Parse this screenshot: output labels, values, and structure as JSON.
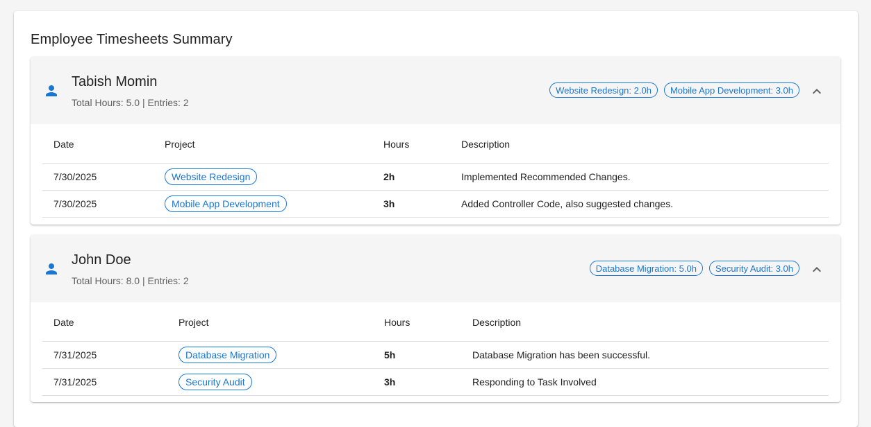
{
  "page": {
    "title": "Employee Timesheets Summary"
  },
  "colors": {
    "accent": "#1976d2",
    "header_bg": "#f5f5f5",
    "divider": "#e0e0e0"
  },
  "icons": {
    "person": "person-icon",
    "collapse": "chevron-up-icon"
  },
  "table_headers": {
    "date": "Date",
    "project": "Project",
    "hours": "Hours",
    "description": "Description"
  },
  "employees": [
    {
      "name": "Tabish Momin",
      "summary": "Total Hours: 5.0 | Entries: 2",
      "chips": [
        "Website Redesign: 2.0h",
        "Mobile App Development: 3.0h"
      ],
      "entries": [
        {
          "date": "7/30/2025",
          "project": "Website Redesign",
          "hours": "2h",
          "description": "Implemented Recommended Changes."
        },
        {
          "date": "7/30/2025",
          "project": "Mobile App Development",
          "hours": "3h",
          "description": "Added Controller Code, also suggested changes."
        }
      ]
    },
    {
      "name": "John Doe",
      "summary": "Total Hours: 8.0 | Entries: 2",
      "chips": [
        "Database Migration: 5.0h",
        "Security Audit: 3.0h"
      ],
      "entries": [
        {
          "date": "7/31/2025",
          "project": "Database Migration",
          "hours": "5h",
          "description": "Database Migration has been successful."
        },
        {
          "date": "7/31/2025",
          "project": "Security Audit",
          "hours": "3h",
          "description": "Responding to Task Involved"
        }
      ]
    }
  ]
}
